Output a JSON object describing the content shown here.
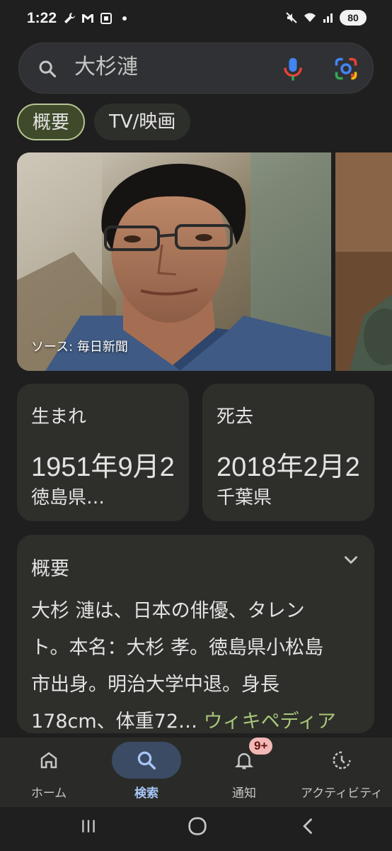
{
  "status_bar": {
    "time": "1:22",
    "battery": "80"
  },
  "search": {
    "query": "大杉漣"
  },
  "chips": [
    {
      "label": "概要",
      "active": true
    },
    {
      "label": "TV/映画",
      "active": false
    }
  ],
  "image": {
    "caption": "ソース: 毎日新聞"
  },
  "born": {
    "label": "生まれ",
    "date": "1951年9月2",
    "place": "徳島県…"
  },
  "died": {
    "label": "死去",
    "date": "2018年2月2",
    "place": "千葉県"
  },
  "overview": {
    "label": "概要",
    "text": "大杉 漣は、日本の俳優、タレント。本名：大杉 孝。徳島県小松島市出身。明治大学中退。身長178cm、体重72…",
    "line1": "大杉 漣は、日本の俳優、タレン",
    "line2": "ト。本名：大杉 孝。徳島県小松島",
    "line3": "市出身。明治大学中退。身長",
    "line4": "178cm、体重72…",
    "source_link": "ウィキペディア"
  },
  "bottom_nav": [
    {
      "label": "ホーム",
      "icon": "home-icon",
      "active": false
    },
    {
      "label": "検索",
      "icon": "search-icon",
      "active": true
    },
    {
      "label": "通知",
      "icon": "bell-icon",
      "active": false,
      "badge": "9+"
    },
    {
      "label": "アクティビティ",
      "icon": "activity-icon",
      "active": false
    }
  ],
  "colors": {
    "background": "#1f1f1f",
    "card": "#2e2f2b",
    "accent_chip": "#3f4a2a",
    "link": "#a8c778",
    "active_nav": "#a8c7fa"
  }
}
